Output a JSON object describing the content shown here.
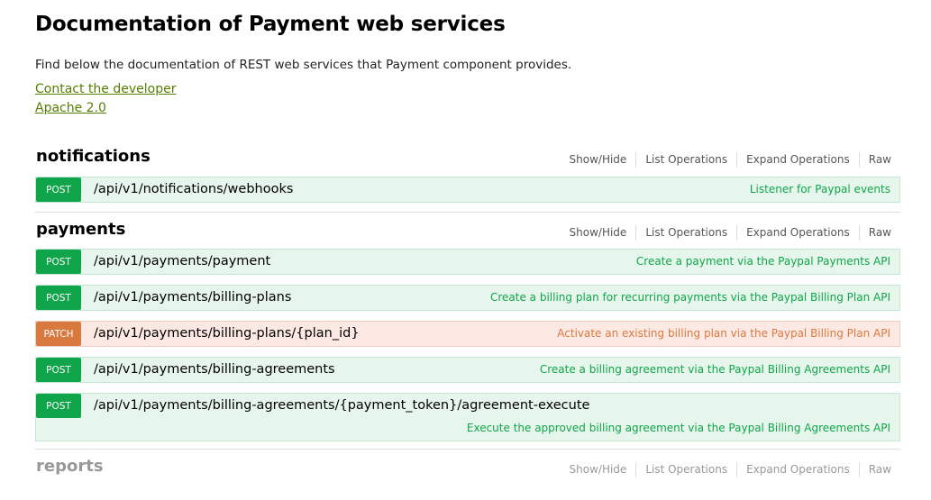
{
  "header": {
    "title": "Documentation of Payment web services",
    "description": "Find below the documentation of REST web services that Payment component provides.",
    "contact_link": "Contact the developer",
    "license_link": "Apache 2.0"
  },
  "resource_options": [
    "Show/Hide",
    "List Operations",
    "Expand Operations",
    "Raw"
  ],
  "colors": {
    "post": "#10a54a",
    "patch": "#d87a3f",
    "link": "#547f00"
  },
  "resources": [
    {
      "name": "notifications",
      "operations": [
        {
          "method": "POST",
          "path": "/api/v1/notifications/webhooks",
          "summary": "Listener for Paypal events"
        }
      ]
    },
    {
      "name": "payments",
      "operations": [
        {
          "method": "POST",
          "path": "/api/v1/payments/payment",
          "summary": "Create a payment via the Paypal Payments API"
        },
        {
          "method": "POST",
          "path": "/api/v1/payments/billing-plans",
          "summary": "Create a billing plan for recurring payments via the Paypal Billing Plan API"
        },
        {
          "method": "PATCH",
          "path": "/api/v1/payments/billing-plans/{plan_id}",
          "summary": "Activate an existing billing plan via the Paypal Billing Plan API"
        },
        {
          "method": "POST",
          "path": "/api/v1/payments/billing-agreements",
          "summary": "Create a billing agreement via the Paypal Billing Agreements API"
        },
        {
          "method": "POST",
          "path": "/api/v1/payments/billing-agreements/{payment_token}/agreement-execute",
          "summary": "Execute the approved billing agreement via the Paypal Billing Agreements API"
        }
      ]
    },
    {
      "name": "reports",
      "operations": []
    }
  ]
}
